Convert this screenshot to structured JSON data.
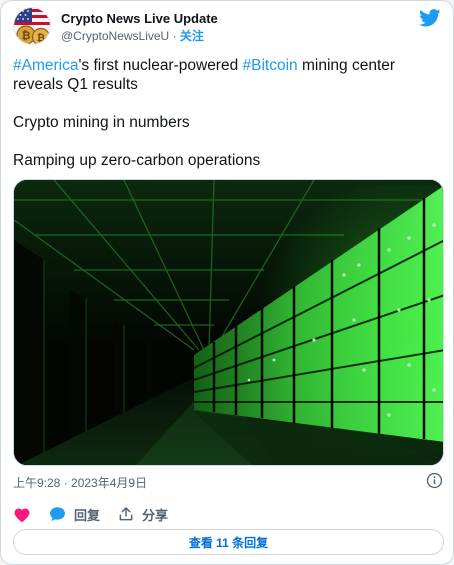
{
  "colors": {
    "link": "#1d9bf0",
    "like": "#f91880",
    "secondary_text": "#536471",
    "server_glow": "#3cf23c"
  },
  "author": {
    "name": "Crypto News Live Update",
    "handle": "@CryptoNewsLiveU",
    "separator": "·",
    "follow_label": "关注",
    "avatar": "flag-and-bitcoin-coins"
  },
  "brand_icon": "twitter-bird-icon",
  "tweet": {
    "line1_tag1": "#America",
    "line1_mid": "'s first nuclear-powered ",
    "line1_tag2": "#Bitcoin",
    "line1_end": " mining center reveals Q1 results",
    "line2": "Crypto mining in numbers",
    "line3": "Ramping up zero-carbon operations"
  },
  "media": {
    "subject": "green-lit bitcoin mining server racks in a long dark hall"
  },
  "timestamp": "上午9:28 · 2023年4月9日",
  "info_icon": "info-circle-icon",
  "actions": {
    "like_icon": "heart-icon",
    "reply_icon": "speech-bubble-icon",
    "reply_label": "回复",
    "share_icon": "share-upload-icon",
    "share_label": "分享"
  },
  "view_replies": "查看 11 条回复"
}
